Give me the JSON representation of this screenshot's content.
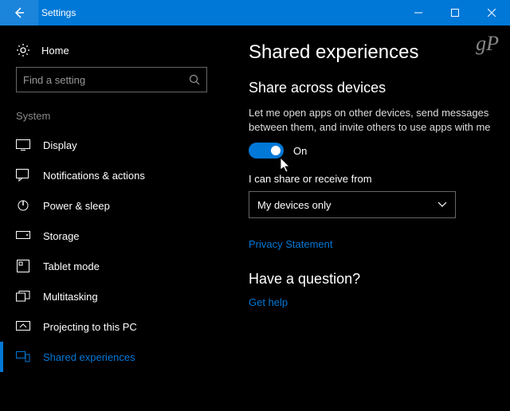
{
  "titlebar": {
    "title": "Settings"
  },
  "sidebar": {
    "home_label": "Home",
    "search_placeholder": "Find a setting",
    "group_label": "System",
    "items": [
      {
        "label": "Display"
      },
      {
        "label": "Notifications & actions"
      },
      {
        "label": "Power & sleep"
      },
      {
        "label": "Storage"
      },
      {
        "label": "Tablet mode"
      },
      {
        "label": "Multitasking"
      },
      {
        "label": "Projecting to this PC"
      },
      {
        "label": "Shared experiences"
      }
    ]
  },
  "main": {
    "heading": "Shared experiences",
    "section1_title": "Share across devices",
    "section1_desc": "Let me open apps on other devices, send messages between them, and invite others to use apps with me",
    "toggle_state": "On",
    "share_from_label": "I can share or receive from",
    "dropdown_value": "My devices only",
    "privacy_link": "Privacy Statement",
    "question_heading": "Have a question?",
    "help_link": "Get help"
  },
  "watermark": "gP"
}
